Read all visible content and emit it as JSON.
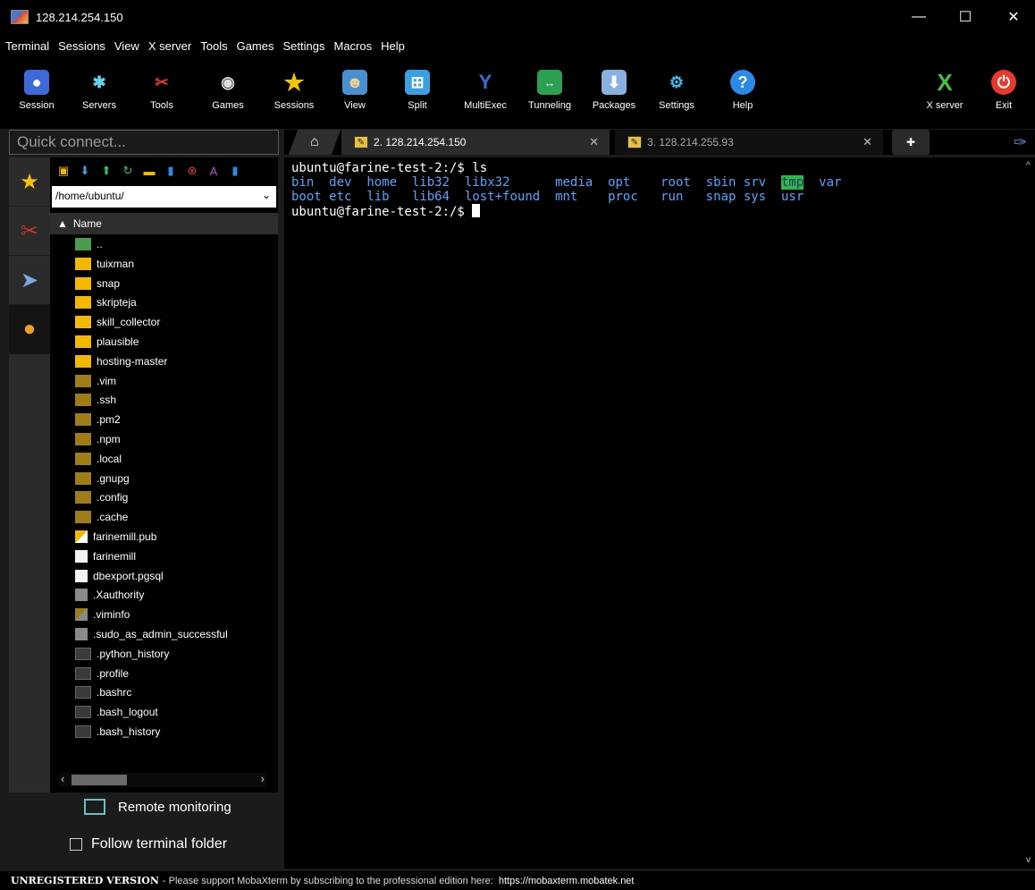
{
  "window": {
    "title": "128.214.254.150",
    "minimize": "—",
    "maximize": "☐",
    "close": "✕"
  },
  "menu": [
    "Terminal",
    "Sessions",
    "View",
    "X server",
    "Tools",
    "Games",
    "Settings",
    "Macros",
    "Help"
  ],
  "toolbar": {
    "session": "Session",
    "servers": "Servers",
    "tools": "Tools",
    "games": "Games",
    "sessions": "Sessions",
    "view": "View",
    "split": "Split",
    "multiexec": "MultiExec",
    "tunneling": "Tunneling",
    "packages": "Packages",
    "settings": "Settings",
    "help": "Help",
    "xserver": "X server",
    "exit": "Exit"
  },
  "quick_connect": {
    "placeholder": "Quick connect..."
  },
  "tabs": [
    {
      "label": "2. 128.214.254.150",
      "close": "✕"
    },
    {
      "label": "3. 128.214.255.93",
      "close": "✕"
    }
  ],
  "sftp": {
    "path": "/home/ubuntu/",
    "name_header": "Name",
    "files": [
      {
        "name": "..",
        "kind": "up"
      },
      {
        "name": "tuixman",
        "kind": "folder"
      },
      {
        "name": "snap",
        "kind": "folder"
      },
      {
        "name": "skripteja",
        "kind": "folder"
      },
      {
        "name": "skill_collector",
        "kind": "folder"
      },
      {
        "name": "plausible",
        "kind": "folder"
      },
      {
        "name": "hosting-master",
        "kind": "folder"
      },
      {
        "name": ".vim",
        "kind": "hidden-folder"
      },
      {
        "name": ".ssh",
        "kind": "hidden-folder"
      },
      {
        "name": ".pm2",
        "kind": "hidden-folder"
      },
      {
        "name": ".npm",
        "kind": "hidden-folder"
      },
      {
        "name": ".local",
        "kind": "hidden-folder"
      },
      {
        "name": ".gnupg",
        "kind": "hidden-folder"
      },
      {
        "name": ".config",
        "kind": "hidden-folder"
      },
      {
        "name": ".cache",
        "kind": "hidden-folder"
      },
      {
        "name": "farinemill.pub",
        "kind": "key-file"
      },
      {
        "name": "farinemill",
        "kind": "file"
      },
      {
        "name": "dbexport.pgsql",
        "kind": "file"
      },
      {
        "name": ".Xauthority",
        "kind": "hidden-file"
      },
      {
        "name": ".viminfo",
        "kind": "hidden-key-file"
      },
      {
        "name": ".sudo_as_admin_successful",
        "kind": "hidden-file"
      },
      {
        "name": ".python_history",
        "kind": "shell-file"
      },
      {
        "name": ".profile",
        "kind": "shell-file"
      },
      {
        "name": ".bashrc",
        "kind": "shell-file"
      },
      {
        "name": ".bash_logout",
        "kind": "shell-file"
      },
      {
        "name": ".bash_history",
        "kind": "shell-file"
      }
    ],
    "remote_monitoring": "Remote monitoring",
    "follow_terminal": "Follow terminal folder"
  },
  "terminal": {
    "prompt1": "ubuntu@farine-test-2:/$ ",
    "command": "ls",
    "row1": [
      "bin",
      "dev",
      "home",
      "lib32",
      "libx32",
      "media",
      "opt",
      "root",
      "sbin",
      "srv",
      "tmp",
      "var"
    ],
    "row2": [
      "boot",
      "etc",
      "lib",
      "lib64",
      "lost+found",
      "mnt",
      "proc",
      "run",
      "snap",
      "sys",
      "usr"
    ],
    "prompt2": "ubuntu@farine-test-2:/$ "
  },
  "status": {
    "unregistered": "UNREGISTERED VERSION",
    "message": " -  Please support MobaXterm by subscribing to the professional edition here:",
    "url": "https://mobaxterm.mobatek.net"
  },
  "colors": {
    "folder": "#f5b800",
    "hidden_folder": "#9e7d18",
    "dir_text": "#54a4ff",
    "tmp_highlight": "#31b844",
    "exit_red": "#e8392b",
    "help_blue": "#2b8ae8"
  }
}
